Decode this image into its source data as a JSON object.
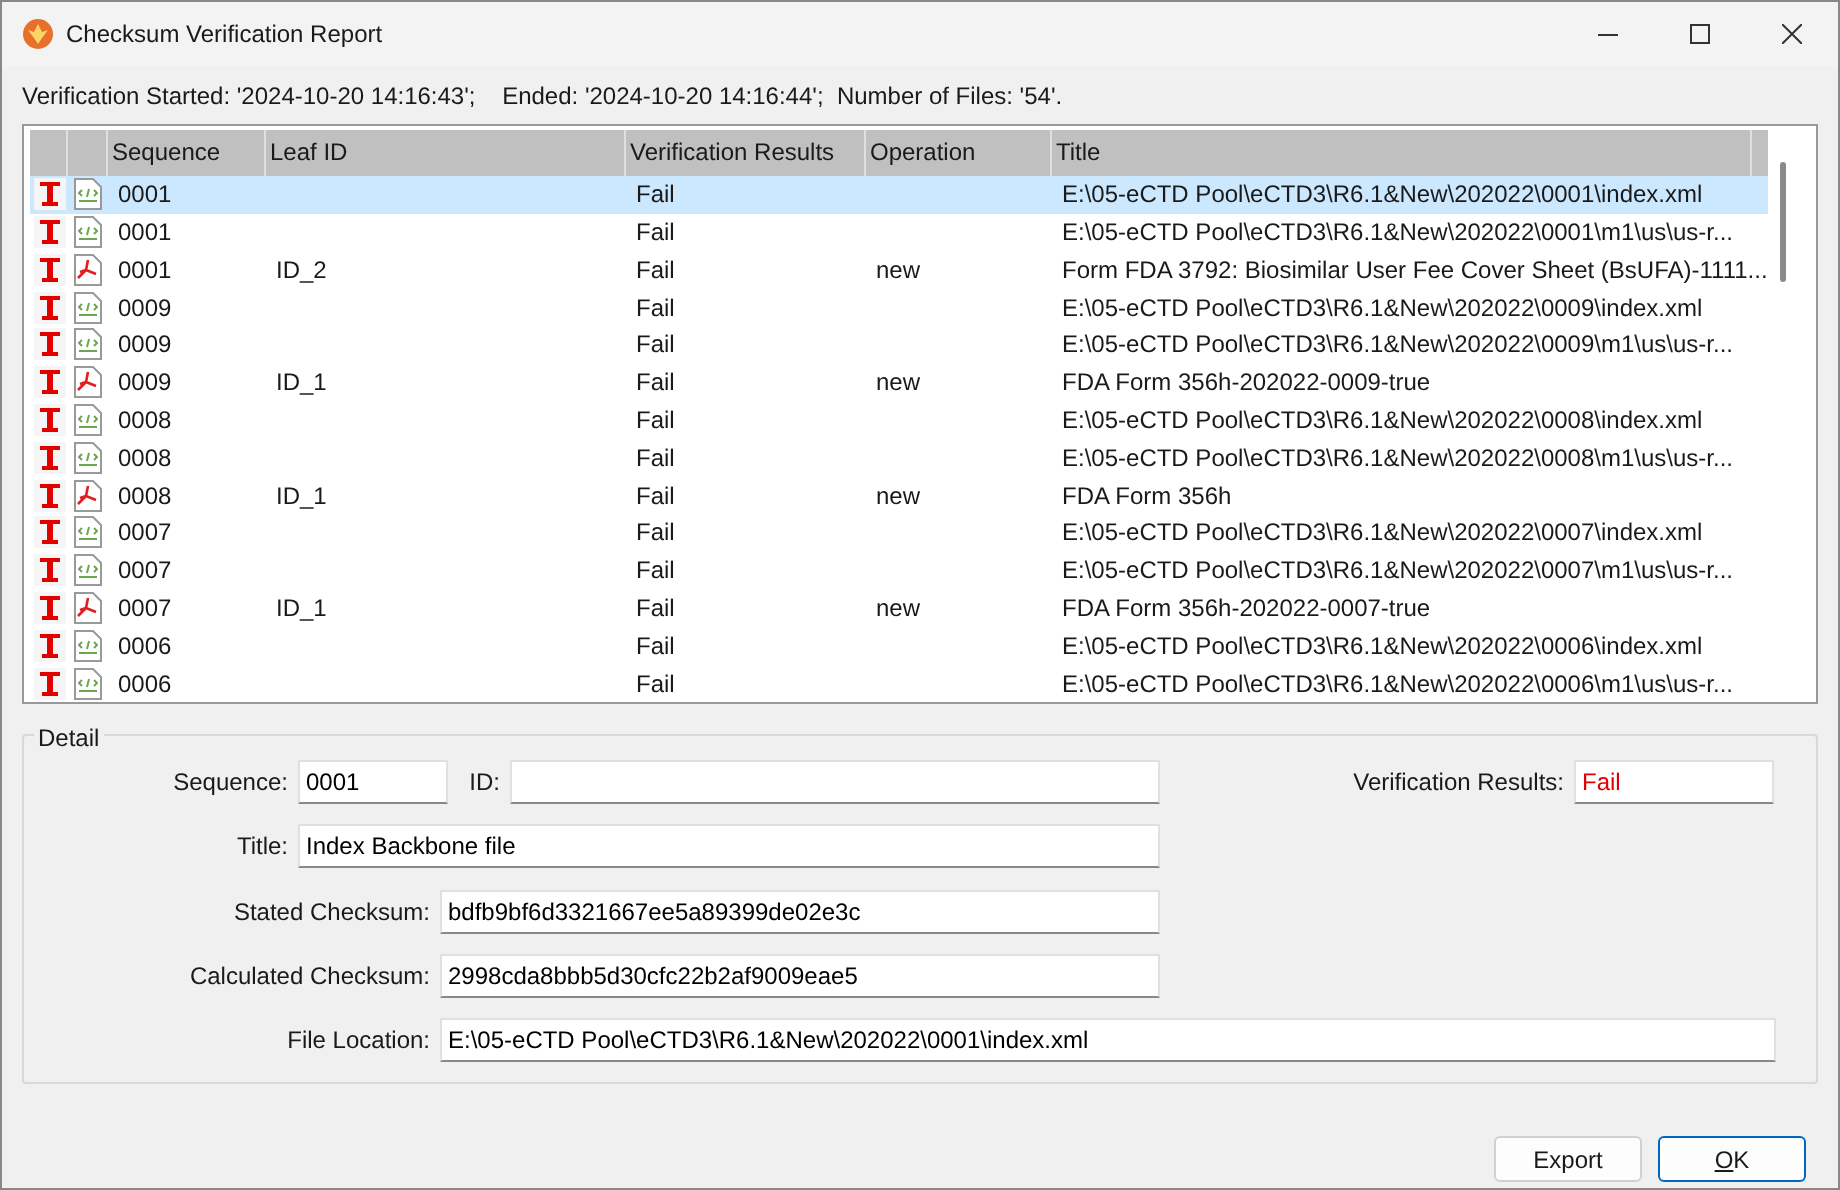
{
  "window": {
    "title": "Checksum Verification Report"
  },
  "summary": "Verification Started: '2024-10-20 14:16:43';    Ended: '2024-10-20 14:16:44';  Number of Files: '54'.",
  "table": {
    "columns": [
      "Sequence",
      "Leaf ID",
      "Verification Results",
      "Operation",
      "Title"
    ],
    "rows": [
      {
        "kind": "xml",
        "selected": true,
        "cells": [
          "0001",
          "",
          "Fail",
          "",
          "E:\\05-eCTD Pool\\eCTD3\\R6.1&New\\202022\\0001\\index.xml"
        ]
      },
      {
        "kind": "xml",
        "selected": false,
        "cells": [
          "0001",
          "",
          "Fail",
          "",
          "E:\\05-eCTD Pool\\eCTD3\\R6.1&New\\202022\\0001\\m1\\us\\us-r..."
        ]
      },
      {
        "kind": "pdf",
        "selected": false,
        "cells": [
          "0001",
          "ID_2",
          "Fail",
          "new",
          "Form FDA 3792: Biosimilar User Fee Cover Sheet (BsUFA)-1111..."
        ]
      },
      {
        "kind": "xml",
        "selected": false,
        "cells": [
          "0009",
          "",
          "Fail",
          "",
          "E:\\05-eCTD Pool\\eCTD3\\R6.1&New\\202022\\0009\\index.xml"
        ]
      },
      {
        "kind": "xml",
        "selected": false,
        "cells": [
          "0009",
          "",
          "Fail",
          "",
          "E:\\05-eCTD Pool\\eCTD3\\R6.1&New\\202022\\0009\\m1\\us\\us-r..."
        ]
      },
      {
        "kind": "pdf",
        "selected": false,
        "cells": [
          "0009",
          "ID_1",
          "Fail",
          "new",
          "FDA Form 356h-202022-0009-true"
        ]
      },
      {
        "kind": "xml",
        "selected": false,
        "cells": [
          "0008",
          "",
          "Fail",
          "",
          "E:\\05-eCTD Pool\\eCTD3\\R6.1&New\\202022\\0008\\index.xml"
        ]
      },
      {
        "kind": "xml",
        "selected": false,
        "cells": [
          "0008",
          "",
          "Fail",
          "",
          "E:\\05-eCTD Pool\\eCTD3\\R6.1&New\\202022\\0008\\m1\\us\\us-r..."
        ]
      },
      {
        "kind": "pdf",
        "selected": false,
        "cells": [
          "0008",
          "ID_1",
          "Fail",
          "new",
          "FDA Form 356h"
        ]
      },
      {
        "kind": "xml",
        "selected": false,
        "cells": [
          "0007",
          "",
          "Fail",
          "",
          "E:\\05-eCTD Pool\\eCTD3\\R6.1&New\\202022\\0007\\index.xml"
        ]
      },
      {
        "kind": "xml",
        "selected": false,
        "cells": [
          "0007",
          "",
          "Fail",
          "",
          "E:\\05-eCTD Pool\\eCTD3\\R6.1&New\\202022\\0007\\m1\\us\\us-r..."
        ]
      },
      {
        "kind": "pdf",
        "selected": false,
        "cells": [
          "0007",
          "ID_1",
          "Fail",
          "new",
          "FDA Form 356h-202022-0007-true"
        ]
      },
      {
        "kind": "xml",
        "selected": false,
        "cells": [
          "0006",
          "",
          "Fail",
          "",
          "E:\\05-eCTD Pool\\eCTD3\\R6.1&New\\202022\\0006\\index.xml"
        ]
      },
      {
        "kind": "xml",
        "selected": false,
        "cells": [
          "0006",
          "",
          "Fail",
          "",
          "E:\\05-eCTD Pool\\eCTD3\\R6.1&New\\202022\\0006\\m1\\us\\us-r..."
        ]
      }
    ]
  },
  "detail": {
    "title": "Detail",
    "sequence": {
      "label": "Sequence:",
      "value": "0001"
    },
    "id": {
      "label": "ID:"
    },
    "verification_results": {
      "label": "Verification Results:",
      "value": "Fail"
    },
    "doc_title": {
      "label": "Title:",
      "value": "Index Backbone file"
    },
    "stated_checksum": {
      "label": "Stated Checksum:",
      "value": "bdfb9bf6d3321667ee5a89399de02e3c"
    },
    "calculated_checksum": {
      "label": "Calculated Checksum:",
      "value": "2998cda8bbb5d30cfc22b2af9009eae5"
    },
    "file_location": {
      "label": "File Location:",
      "value": "E:\\05-eCTD Pool\\eCTD3\\R6.1&New\\202022\\0001\\index.xml"
    }
  },
  "buttons": [
    "Export",
    "OK"
  ]
}
